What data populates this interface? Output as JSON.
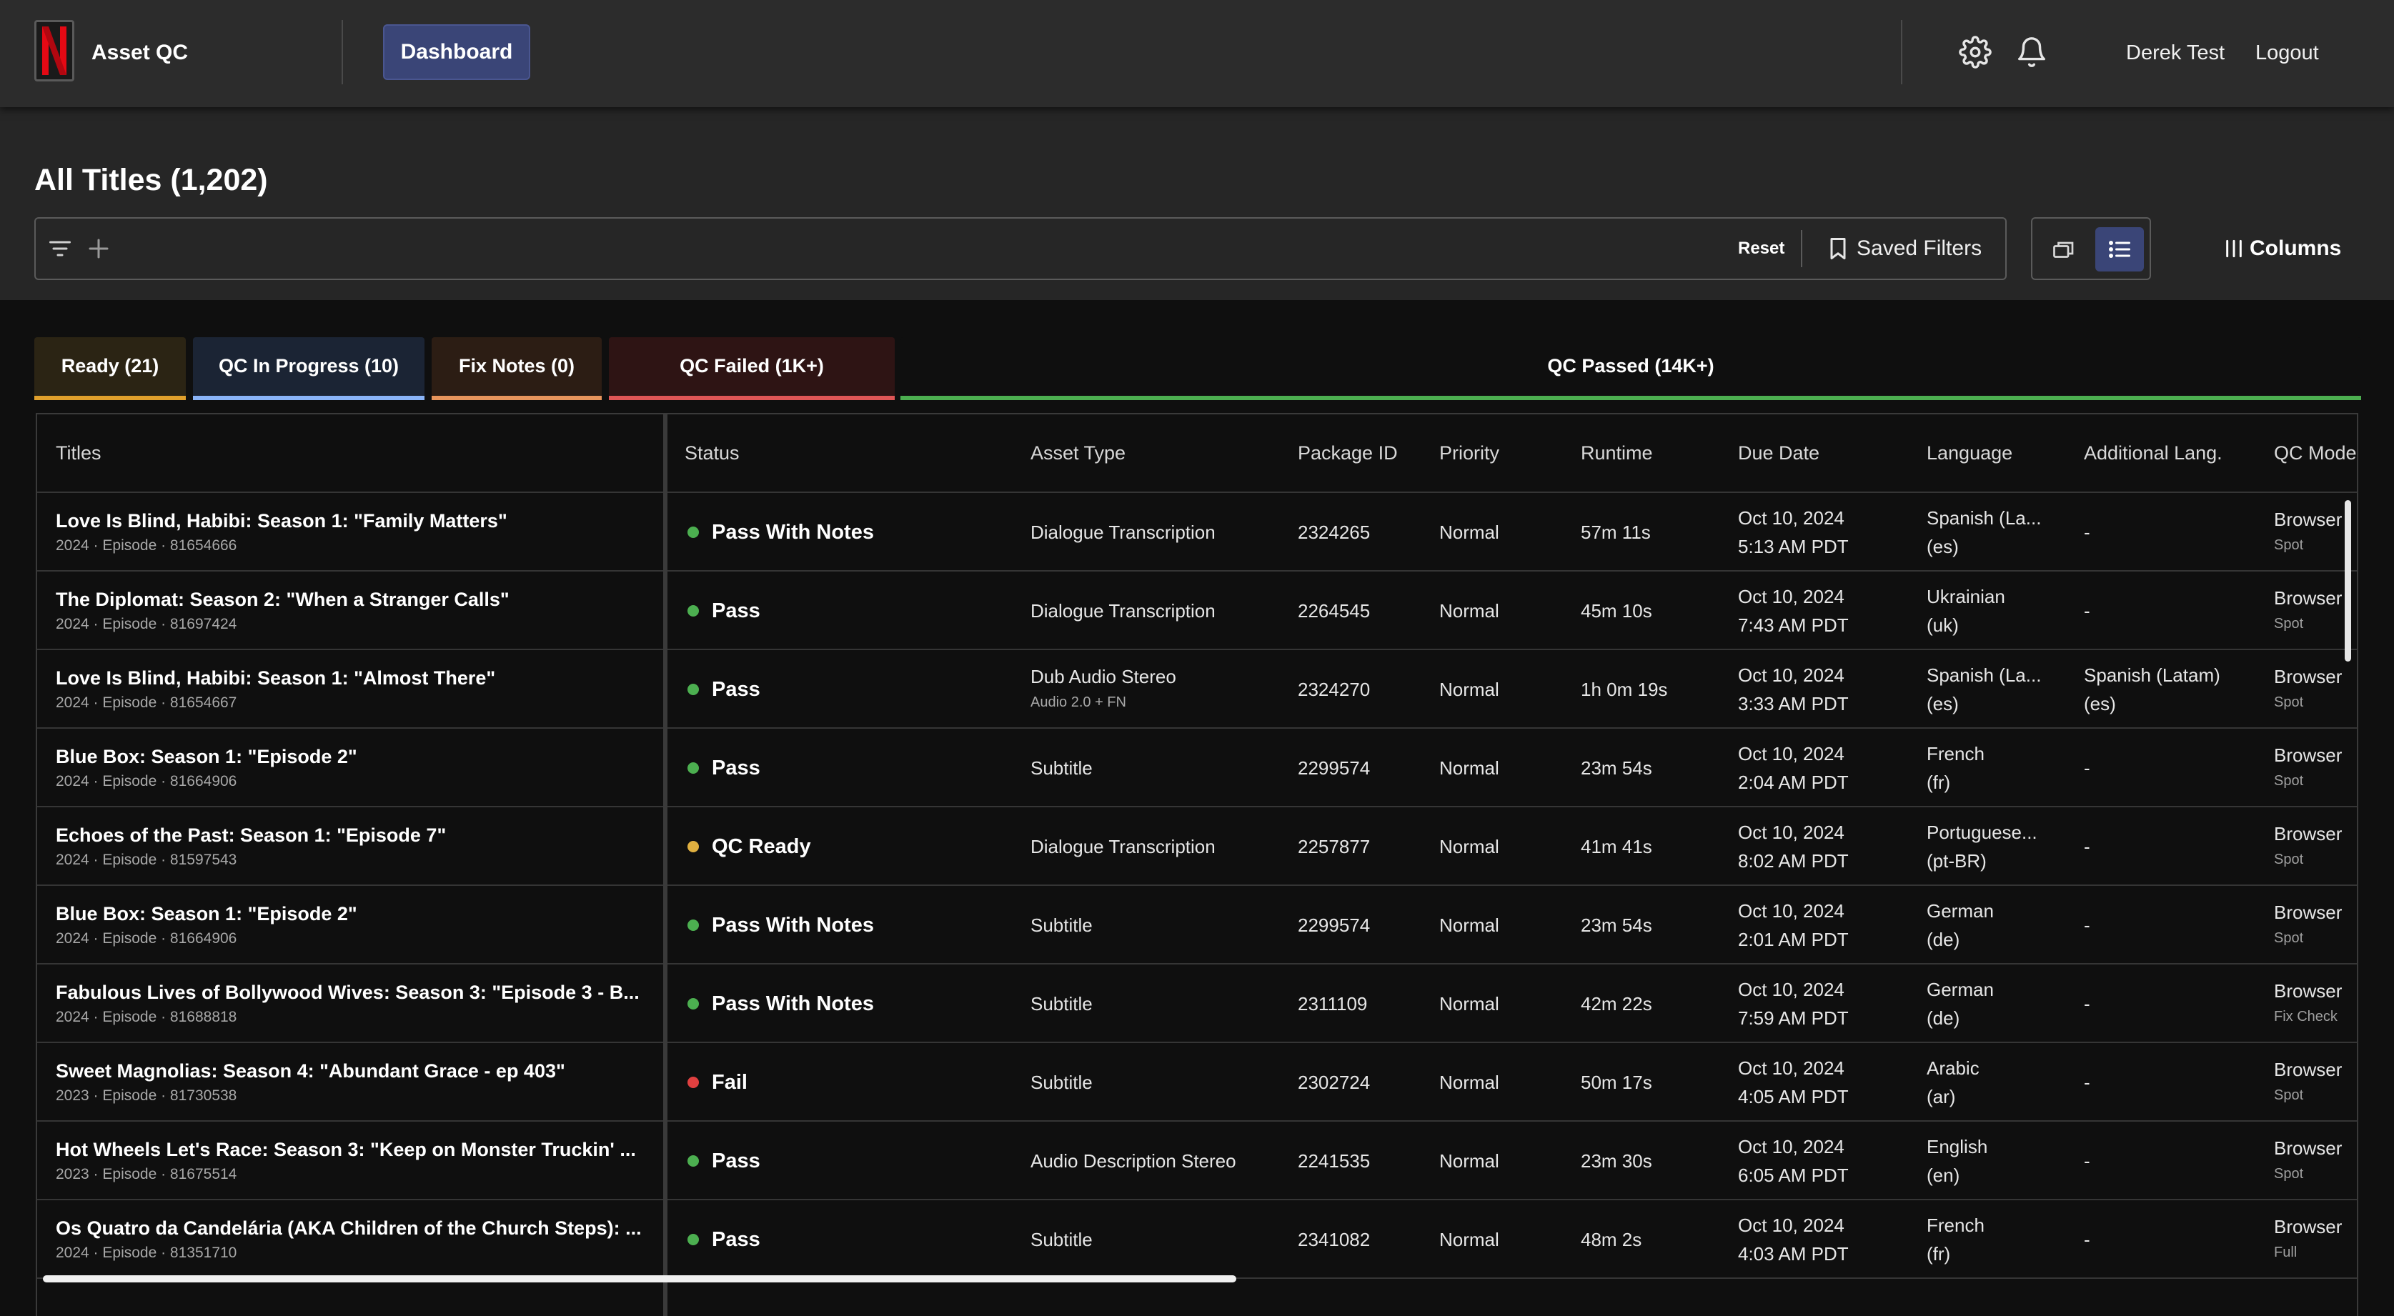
{
  "header": {
    "app_title": "Asset QC",
    "nav": {
      "dashboard_label": "Dashboard"
    },
    "icons": [
      "gear-icon",
      "bell-icon"
    ],
    "user_name": "Derek Test",
    "logout_label": "Logout"
  },
  "page": {
    "title": "All Titles (1,202)"
  },
  "filter_bar": {
    "reset_label": "Reset",
    "saved_filters_label": "Saved Filters",
    "columns_label": "Columns"
  },
  "tabs": [
    {
      "label": "Ready (21)",
      "color": "#e0a02c",
      "bg": "#2b2414"
    },
    {
      "label": "QC In Progress (10)",
      "color": "#8ab4f8",
      "bg": "#1b2434"
    },
    {
      "label": "Fix Notes (0)",
      "color": "#e8955c",
      "bg": "#2c1d14"
    },
    {
      "label": "QC Failed (1K+)",
      "color": "#e05656",
      "bg": "#2e1414"
    },
    {
      "label": "QC Passed (14K+)",
      "color": "#4caf50",
      "bg": "#0f0f0f"
    }
  ],
  "table": {
    "columns": [
      "Titles",
      "Status",
      "Asset Type",
      "Package ID",
      "Priority",
      "Runtime",
      "Due Date",
      "Language",
      "Additional Lang.",
      "QC Mode"
    ],
    "status_colors": {
      "pass": "#4caf50",
      "ready": "#e0b040",
      "fail": "#e04040"
    },
    "rows": [
      {
        "title": "Love Is Blind, Habibi: Season 1: \"Family Matters\"",
        "sub": "2024 · Episode · 81654666",
        "status": "Pass With Notes",
        "status_color": "#4caf50",
        "asset_type": "Dialogue Transcription",
        "asset_sub": "",
        "package_id": "2324265",
        "priority": "Normal",
        "runtime": "57m 11s",
        "due_date": "Oct 10, 2024",
        "due_time": "5:13 AM PDT",
        "language": "Spanish (La...",
        "language_code": "(es)",
        "add_lang": "-",
        "add_lang_code": "",
        "qc_mode": "Browser",
        "qc_mode_sub": "Spot"
      },
      {
        "title": "The Diplomat: Season 2: \"When a Stranger Calls\"",
        "sub": "2024 · Episode · 81697424",
        "status": "Pass",
        "status_color": "#4caf50",
        "asset_type": "Dialogue Transcription",
        "asset_sub": "",
        "package_id": "2264545",
        "priority": "Normal",
        "runtime": "45m 10s",
        "due_date": "Oct 10, 2024",
        "due_time": "7:43 AM PDT",
        "language": "Ukrainian",
        "language_code": "(uk)",
        "add_lang": "-",
        "add_lang_code": "",
        "qc_mode": "Browser",
        "qc_mode_sub": "Spot"
      },
      {
        "title": "Love Is Blind, Habibi: Season 1: \"Almost There\"",
        "sub": "2024 · Episode · 81654667",
        "status": "Pass",
        "status_color": "#4caf50",
        "asset_type": "Dub Audio Stereo",
        "asset_sub": "Audio 2.0 + FN",
        "package_id": "2324270",
        "priority": "Normal",
        "runtime": "1h 0m 19s",
        "due_date": "Oct 10, 2024",
        "due_time": "3:33 AM PDT",
        "language": "Spanish (La...",
        "language_code": "(es)",
        "add_lang": "Spanish (Latam)",
        "add_lang_code": "(es)",
        "qc_mode": "Browser",
        "qc_mode_sub": "Spot"
      },
      {
        "title": "Blue Box: Season 1: \"Episode 2\"",
        "sub": "2024 · Episode · 81664906",
        "status": "Pass",
        "status_color": "#4caf50",
        "asset_type": "Subtitle",
        "asset_sub": "",
        "package_id": "2299574",
        "priority": "Normal",
        "runtime": "23m 54s",
        "due_date": "Oct 10, 2024",
        "due_time": "2:04 AM PDT",
        "language": "French",
        "language_code": "(fr)",
        "add_lang": "-",
        "add_lang_code": "",
        "qc_mode": "Browser",
        "qc_mode_sub": "Spot"
      },
      {
        "title": "Echoes of the Past: Season 1: \"Episode 7\"",
        "sub": "2024 · Episode · 81597543",
        "status": "QC Ready",
        "status_color": "#e0b040",
        "asset_type": "Dialogue Transcription",
        "asset_sub": "",
        "package_id": "2257877",
        "priority": "Normal",
        "runtime": "41m 41s",
        "due_date": "Oct 10, 2024",
        "due_time": "8:02 AM PDT",
        "language": "Portuguese...",
        "language_code": "(pt-BR)",
        "add_lang": "-",
        "add_lang_code": "",
        "qc_mode": "Browser",
        "qc_mode_sub": "Spot"
      },
      {
        "title": "Blue Box: Season 1: \"Episode 2\"",
        "sub": "2024 · Episode · 81664906",
        "status": "Pass With Notes",
        "status_color": "#4caf50",
        "asset_type": "Subtitle",
        "asset_sub": "",
        "package_id": "2299574",
        "priority": "Normal",
        "runtime": "23m 54s",
        "due_date": "Oct 10, 2024",
        "due_time": "2:01 AM PDT",
        "language": "German",
        "language_code": "(de)",
        "add_lang": "-",
        "add_lang_code": "",
        "qc_mode": "Browser",
        "qc_mode_sub": "Spot"
      },
      {
        "title": "Fabulous Lives of Bollywood Wives: Season 3: \"Episode 3 - B...",
        "sub": "2024 · Episode · 81688818",
        "status": "Pass With Notes",
        "status_color": "#4caf50",
        "asset_type": "Subtitle",
        "asset_sub": "",
        "package_id": "2311109",
        "priority": "Normal",
        "runtime": "42m 22s",
        "due_date": "Oct 10, 2024",
        "due_time": "7:59 AM PDT",
        "language": "German",
        "language_code": "(de)",
        "add_lang": "-",
        "add_lang_code": "",
        "qc_mode": "Browser",
        "qc_mode_sub": "Fix Check"
      },
      {
        "title": "Sweet Magnolias: Season 4: \"Abundant Grace - ep 403\"",
        "sub": "2023 · Episode · 81730538",
        "status": "Fail",
        "status_color": "#e04040",
        "asset_type": "Subtitle",
        "asset_sub": "",
        "package_id": "2302724",
        "priority": "Normal",
        "runtime": "50m 17s",
        "due_date": "Oct 10, 2024",
        "due_time": "4:05 AM PDT",
        "language": "Arabic",
        "language_code": "(ar)",
        "add_lang": "-",
        "add_lang_code": "",
        "qc_mode": "Browser",
        "qc_mode_sub": "Spot"
      },
      {
        "title": "Hot Wheels Let's Race: Season 3: \"Keep on Monster Truckin' ...",
        "sub": "2023 · Episode · 81675514",
        "status": "Pass",
        "status_color": "#4caf50",
        "asset_type": "Audio Description Stereo",
        "asset_sub": "",
        "package_id": "2241535",
        "priority": "Normal",
        "runtime": "23m 30s",
        "due_date": "Oct 10, 2024",
        "due_time": "6:05 AM PDT",
        "language": "English",
        "language_code": "(en)",
        "add_lang": "-",
        "add_lang_code": "",
        "qc_mode": "Browser",
        "qc_mode_sub": "Spot"
      },
      {
        "title": "Os Quatro da Candelária (AKA Children of the Church Steps): ...",
        "sub": "2024 · Episode · 81351710",
        "status": "Pass",
        "status_color": "#4caf50",
        "asset_type": "Subtitle",
        "asset_sub": "",
        "package_id": "2341082",
        "priority": "Normal",
        "runtime": "48m 2s",
        "due_date": "Oct 10, 2024",
        "due_time": "4:03 AM PDT",
        "language": "French",
        "language_code": "(fr)",
        "add_lang": "-",
        "add_lang_code": "",
        "qc_mode": "Browser",
        "qc_mode_sub": "Full"
      }
    ]
  }
}
